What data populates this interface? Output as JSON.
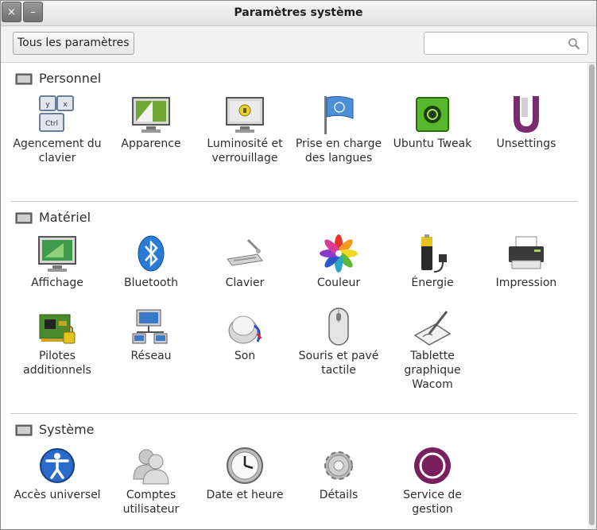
{
  "window": {
    "title": "Paramètres système",
    "close_label": "×",
    "minimize_label": "–"
  },
  "toolbar": {
    "all_settings_label": "Tous les paramètres",
    "search_value": "",
    "search_placeholder": ""
  },
  "sections": [
    {
      "title": "Personnel",
      "items": [
        {
          "label": "Agencement du clavier",
          "icon": "keyboard-layout-icon"
        },
        {
          "label": "Apparence",
          "icon": "appearance-icon"
        },
        {
          "label": "Luminosité et verrouillage",
          "icon": "brightness-lock-icon"
        },
        {
          "label": "Prise en charge des langues",
          "icon": "language-flag-icon"
        },
        {
          "label": "Ubuntu Tweak",
          "icon": "ubuntu-tweak-icon"
        },
        {
          "label": "Unsettings",
          "icon": "unsettings-icon"
        }
      ]
    },
    {
      "title": "Matériel",
      "items": [
        {
          "label": "Affichage",
          "icon": "display-icon"
        },
        {
          "label": "Bluetooth",
          "icon": "bluetooth-icon"
        },
        {
          "label": "Clavier",
          "icon": "keyboard-icon"
        },
        {
          "label": "Couleur",
          "icon": "color-icon"
        },
        {
          "label": "Énergie",
          "icon": "power-icon"
        },
        {
          "label": "Impression",
          "icon": "printer-icon"
        },
        {
          "label": "Pilotes additionnels",
          "icon": "drivers-icon"
        },
        {
          "label": "Réseau",
          "icon": "network-icon"
        },
        {
          "label": "Son",
          "icon": "sound-icon"
        },
        {
          "label": "Souris et pavé tactile",
          "icon": "mouse-icon"
        },
        {
          "label": "Tablette graphique Wacom",
          "icon": "tablet-icon"
        }
      ]
    },
    {
      "title": "Système",
      "items": [
        {
          "label": "Accès universel",
          "icon": "accessibility-icon"
        },
        {
          "label": "Comptes utilisateur",
          "icon": "user-accounts-icon"
        },
        {
          "label": "Date et heure",
          "icon": "clock-icon"
        },
        {
          "label": "Détails",
          "icon": "details-gear-icon"
        },
        {
          "label": "Service de gestion",
          "icon": "management-service-icon"
        }
      ]
    }
  ]
}
